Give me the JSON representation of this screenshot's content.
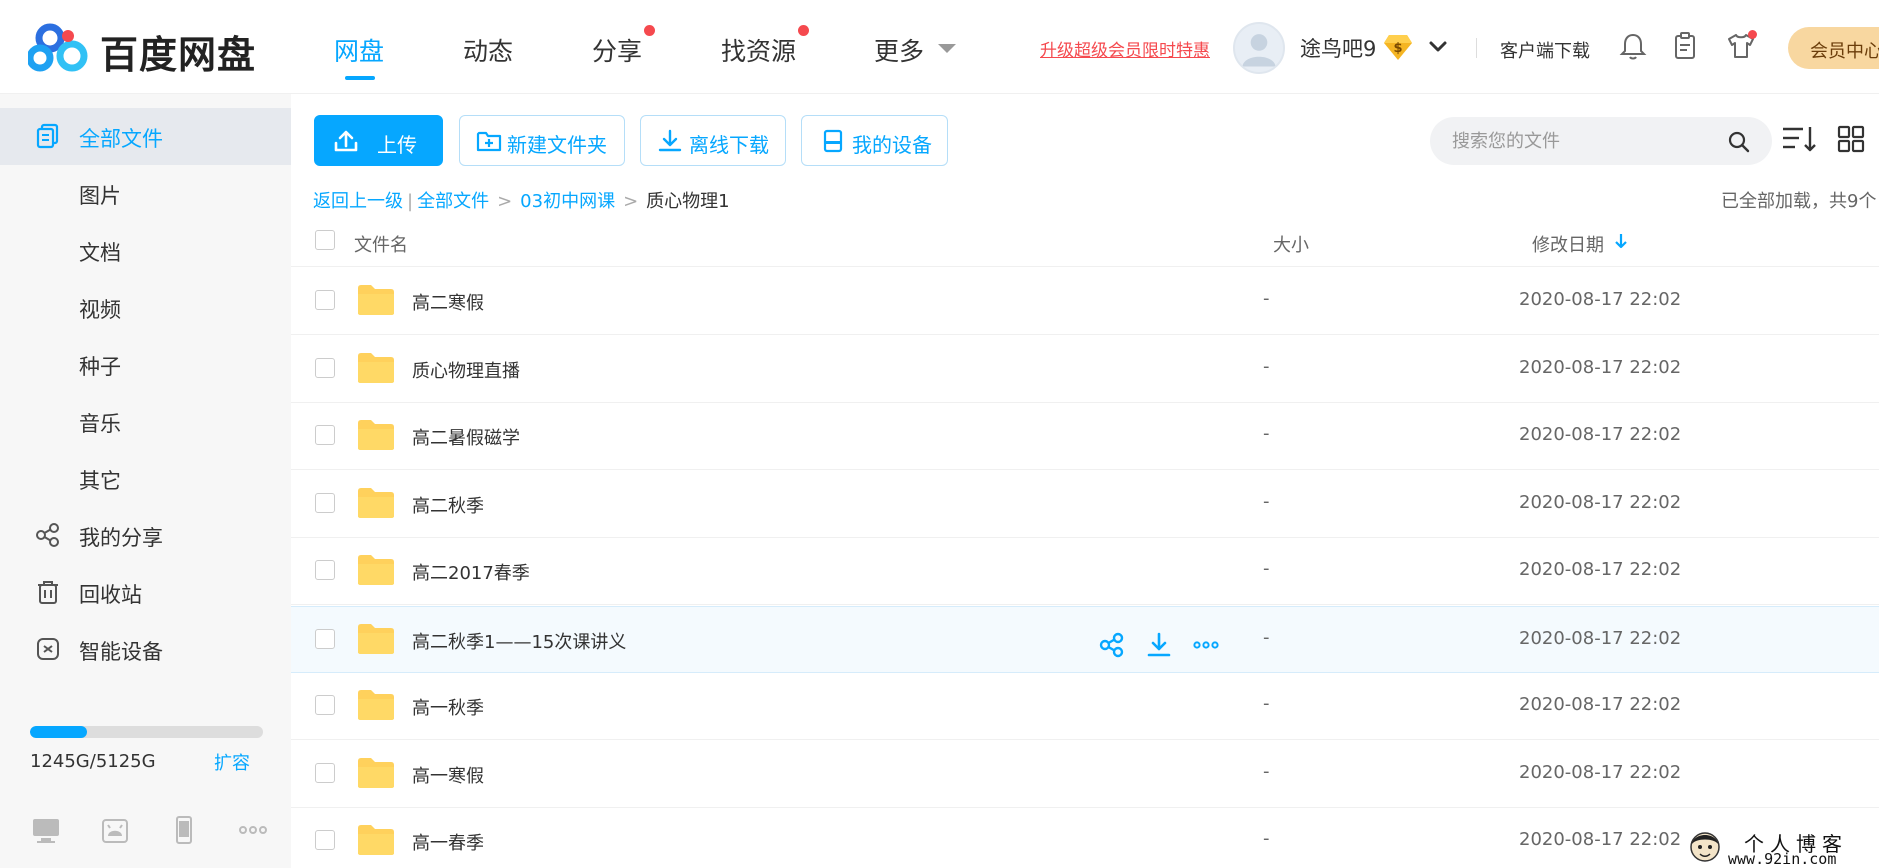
{
  "header": {
    "brand": "百度网盘",
    "nav": [
      {
        "label": "网盘",
        "active": true
      },
      {
        "label": "动态"
      },
      {
        "label": "分享",
        "dot": true
      },
      {
        "label": "找资源",
        "dot": true
      },
      {
        "label": "更多"
      }
    ],
    "promo": "升级超级会员限时特惠",
    "username": "途鸟吧9",
    "vip_badge": "$",
    "client_download": "客户端下载",
    "member_center": "会员中心"
  },
  "sidebar": {
    "items": [
      {
        "label": "全部文件",
        "active": true,
        "icon": "files-icon"
      },
      {
        "label": "图片"
      },
      {
        "label": "文档"
      },
      {
        "label": "视频"
      },
      {
        "label": "种子"
      },
      {
        "label": "音乐"
      },
      {
        "label": "其它"
      },
      {
        "label": "我的分享",
        "icon": "share-icon"
      },
      {
        "label": "回收站",
        "icon": "trash-icon"
      },
      {
        "label": "智能设备",
        "icon": "smart-device-icon"
      }
    ],
    "storage": {
      "text": "1245G/5125G",
      "used_fraction": 0.243
    },
    "expand": "扩容"
  },
  "toolbar": {
    "upload": "上传",
    "new_folder": "新建文件夹",
    "offline_download": "离线下载",
    "my_devices": "我的设备",
    "search_placeholder": "搜索您的文件"
  },
  "breadcrumb": {
    "back": "返回上一级",
    "all": "全部文件",
    "level1": "03初中网课",
    "current": "质心物理1",
    "loaded": "已全部加载，共9个"
  },
  "table": {
    "headers": {
      "name": "文件名",
      "size": "大小",
      "date": "修改日期"
    },
    "rows": [
      {
        "name": "高二寒假",
        "size": "-",
        "date": "2020-08-17 22:02"
      },
      {
        "name": "质心物理直播",
        "size": "-",
        "date": "2020-08-17 22:02"
      },
      {
        "name": "高二暑假磁学",
        "size": "-",
        "date": "2020-08-17 22:02"
      },
      {
        "name": "高二秋季",
        "size": "-",
        "date": "2020-08-17 22:02"
      },
      {
        "name": "高二2017春季",
        "size": "-",
        "date": "2020-08-17 22:02"
      },
      {
        "name": "高二秋季1——15次课讲义",
        "size": "-",
        "date": "2020-08-17 22:02",
        "hover": true
      },
      {
        "name": "高一秋季",
        "size": "-",
        "date": "2020-08-17 22:02"
      },
      {
        "name": "高一寒假",
        "size": "-",
        "date": "2020-08-17 22:02"
      },
      {
        "name": "高一春季",
        "size": "-",
        "date": "2020-08-17 22:02"
      }
    ]
  },
  "watermark": {
    "title": "个人博客",
    "url": "www.92in.com"
  },
  "colors": {
    "accent": "#06a7ff",
    "red": "#f5494e",
    "folder": "#ffd15c",
    "member": "#f8d7a0"
  }
}
